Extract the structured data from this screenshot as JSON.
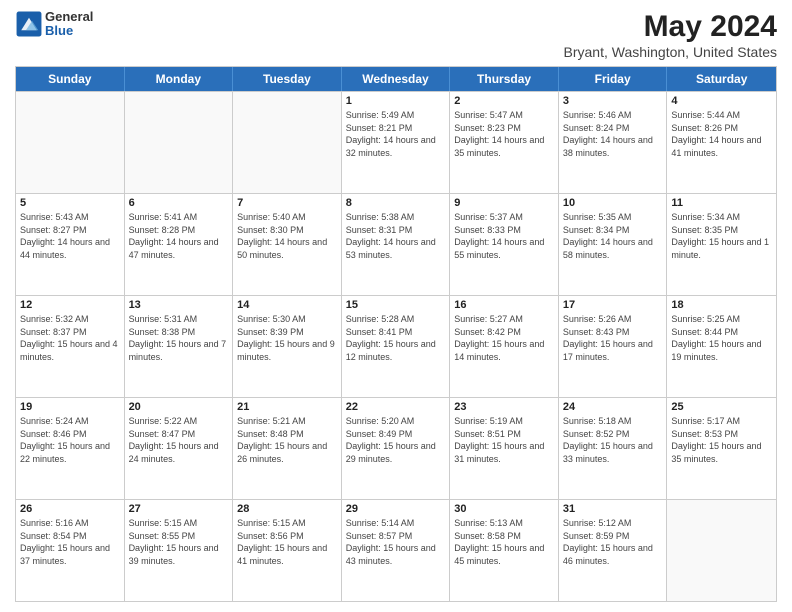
{
  "header": {
    "logo_general": "General",
    "logo_blue": "Blue",
    "month_title": "May 2024",
    "subtitle": "Bryant, Washington, United States"
  },
  "days_of_week": [
    "Sunday",
    "Monday",
    "Tuesday",
    "Wednesday",
    "Thursday",
    "Friday",
    "Saturday"
  ],
  "weeks": [
    [
      {
        "day": "",
        "empty": true
      },
      {
        "day": "",
        "empty": true
      },
      {
        "day": "",
        "empty": true
      },
      {
        "day": "1",
        "sunrise": "5:49 AM",
        "sunset": "8:21 PM",
        "daylight": "14 hours and 32 minutes."
      },
      {
        "day": "2",
        "sunrise": "5:47 AM",
        "sunset": "8:23 PM",
        "daylight": "14 hours and 35 minutes."
      },
      {
        "day": "3",
        "sunrise": "5:46 AM",
        "sunset": "8:24 PM",
        "daylight": "14 hours and 38 minutes."
      },
      {
        "day": "4",
        "sunrise": "5:44 AM",
        "sunset": "8:26 PM",
        "daylight": "14 hours and 41 minutes."
      }
    ],
    [
      {
        "day": "5",
        "sunrise": "5:43 AM",
        "sunset": "8:27 PM",
        "daylight": "14 hours and 44 minutes."
      },
      {
        "day": "6",
        "sunrise": "5:41 AM",
        "sunset": "8:28 PM",
        "daylight": "14 hours and 47 minutes."
      },
      {
        "day": "7",
        "sunrise": "5:40 AM",
        "sunset": "8:30 PM",
        "daylight": "14 hours and 50 minutes."
      },
      {
        "day": "8",
        "sunrise": "5:38 AM",
        "sunset": "8:31 PM",
        "daylight": "14 hours and 53 minutes."
      },
      {
        "day": "9",
        "sunrise": "5:37 AM",
        "sunset": "8:33 PM",
        "daylight": "14 hours and 55 minutes."
      },
      {
        "day": "10",
        "sunrise": "5:35 AM",
        "sunset": "8:34 PM",
        "daylight": "14 hours and 58 minutes."
      },
      {
        "day": "11",
        "sunrise": "5:34 AM",
        "sunset": "8:35 PM",
        "daylight": "15 hours and 1 minute."
      }
    ],
    [
      {
        "day": "12",
        "sunrise": "5:32 AM",
        "sunset": "8:37 PM",
        "daylight": "15 hours and 4 minutes."
      },
      {
        "day": "13",
        "sunrise": "5:31 AM",
        "sunset": "8:38 PM",
        "daylight": "15 hours and 7 minutes."
      },
      {
        "day": "14",
        "sunrise": "5:30 AM",
        "sunset": "8:39 PM",
        "daylight": "15 hours and 9 minutes."
      },
      {
        "day": "15",
        "sunrise": "5:28 AM",
        "sunset": "8:41 PM",
        "daylight": "15 hours and 12 minutes."
      },
      {
        "day": "16",
        "sunrise": "5:27 AM",
        "sunset": "8:42 PM",
        "daylight": "15 hours and 14 minutes."
      },
      {
        "day": "17",
        "sunrise": "5:26 AM",
        "sunset": "8:43 PM",
        "daylight": "15 hours and 17 minutes."
      },
      {
        "day": "18",
        "sunrise": "5:25 AM",
        "sunset": "8:44 PM",
        "daylight": "15 hours and 19 minutes."
      }
    ],
    [
      {
        "day": "19",
        "sunrise": "5:24 AM",
        "sunset": "8:46 PM",
        "daylight": "15 hours and 22 minutes."
      },
      {
        "day": "20",
        "sunrise": "5:22 AM",
        "sunset": "8:47 PM",
        "daylight": "15 hours and 24 minutes."
      },
      {
        "day": "21",
        "sunrise": "5:21 AM",
        "sunset": "8:48 PM",
        "daylight": "15 hours and 26 minutes."
      },
      {
        "day": "22",
        "sunrise": "5:20 AM",
        "sunset": "8:49 PM",
        "daylight": "15 hours and 29 minutes."
      },
      {
        "day": "23",
        "sunrise": "5:19 AM",
        "sunset": "8:51 PM",
        "daylight": "15 hours and 31 minutes."
      },
      {
        "day": "24",
        "sunrise": "5:18 AM",
        "sunset": "8:52 PM",
        "daylight": "15 hours and 33 minutes."
      },
      {
        "day": "25",
        "sunrise": "5:17 AM",
        "sunset": "8:53 PM",
        "daylight": "15 hours and 35 minutes."
      }
    ],
    [
      {
        "day": "26",
        "sunrise": "5:16 AM",
        "sunset": "8:54 PM",
        "daylight": "15 hours and 37 minutes."
      },
      {
        "day": "27",
        "sunrise": "5:15 AM",
        "sunset": "8:55 PM",
        "daylight": "15 hours and 39 minutes."
      },
      {
        "day": "28",
        "sunrise": "5:15 AM",
        "sunset": "8:56 PM",
        "daylight": "15 hours and 41 minutes."
      },
      {
        "day": "29",
        "sunrise": "5:14 AM",
        "sunset": "8:57 PM",
        "daylight": "15 hours and 43 minutes."
      },
      {
        "day": "30",
        "sunrise": "5:13 AM",
        "sunset": "8:58 PM",
        "daylight": "15 hours and 45 minutes."
      },
      {
        "day": "31",
        "sunrise": "5:12 AM",
        "sunset": "8:59 PM",
        "daylight": "15 hours and 46 minutes."
      },
      {
        "day": "",
        "empty": true
      }
    ]
  ],
  "labels": {
    "sunrise_prefix": "Sunrise: ",
    "sunset_prefix": "Sunset: ",
    "daylight_prefix": "Daylight: "
  }
}
